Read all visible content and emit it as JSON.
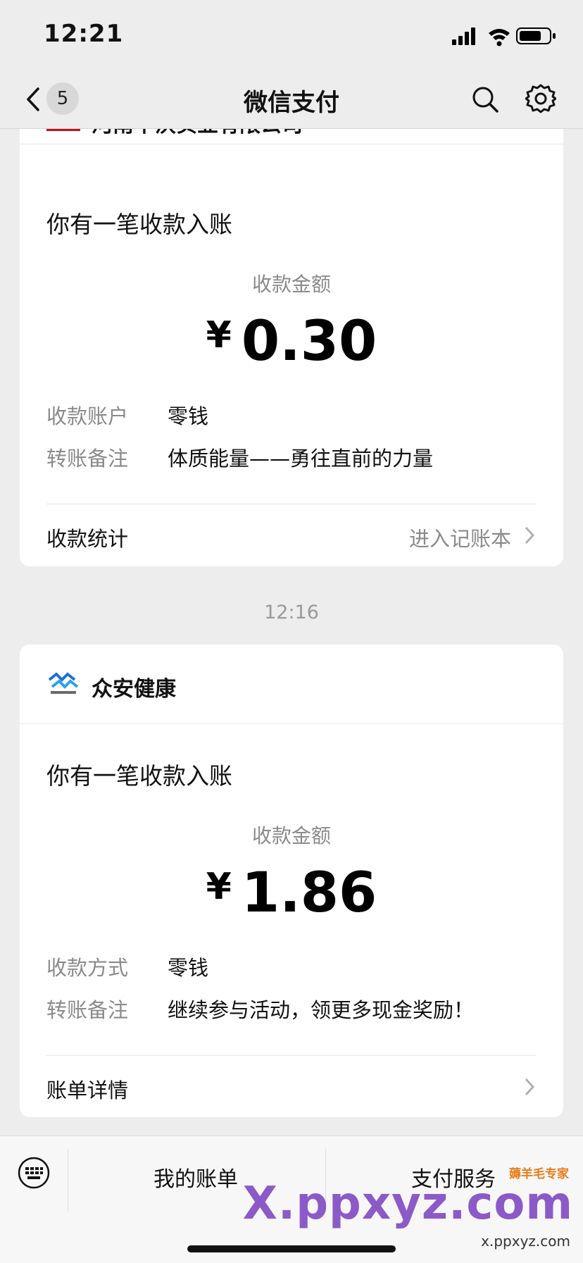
{
  "status_bar": {
    "time": "12:21"
  },
  "nav": {
    "badge_count": "5",
    "title": "微信支付",
    "icons": [
      "back-icon",
      "search-icon",
      "gear-icon"
    ]
  },
  "card1": {
    "merchant_name": "河南中沃实业有限公司",
    "headline": "你有一笔收款入账",
    "amount_label": "收款金额",
    "currency": "¥",
    "amount": "0.30",
    "rows": [
      {
        "key": "收款账户",
        "value": "零钱"
      },
      {
        "key": "转账备注",
        "value": "体质能量——勇往直前的力量"
      }
    ],
    "footer_left": "收款统计",
    "footer_right": "进入记账本"
  },
  "timestamp": "12:16",
  "card2": {
    "merchant_name": "众安健康",
    "headline": "你有一笔收款入账",
    "amount_label": "收款金额",
    "currency": "¥",
    "amount": "1.86",
    "rows": [
      {
        "key": "收款方式",
        "value": "零钱"
      },
      {
        "key": "转账备注",
        "value": "继续参与活动，领更多现金奖励！"
      }
    ],
    "footer_left": "账单详情"
  },
  "bottom_bar": {
    "item1": "我的账单",
    "item2": "支付服务"
  },
  "watermark": {
    "big": "X.ppxyz.com",
    "small": "x.ppxyz.com",
    "cn": "薅羊毛专家"
  },
  "colors": {
    "background": "#ededed",
    "card": "#ffffff",
    "muted_text": "#8a8a8a"
  }
}
